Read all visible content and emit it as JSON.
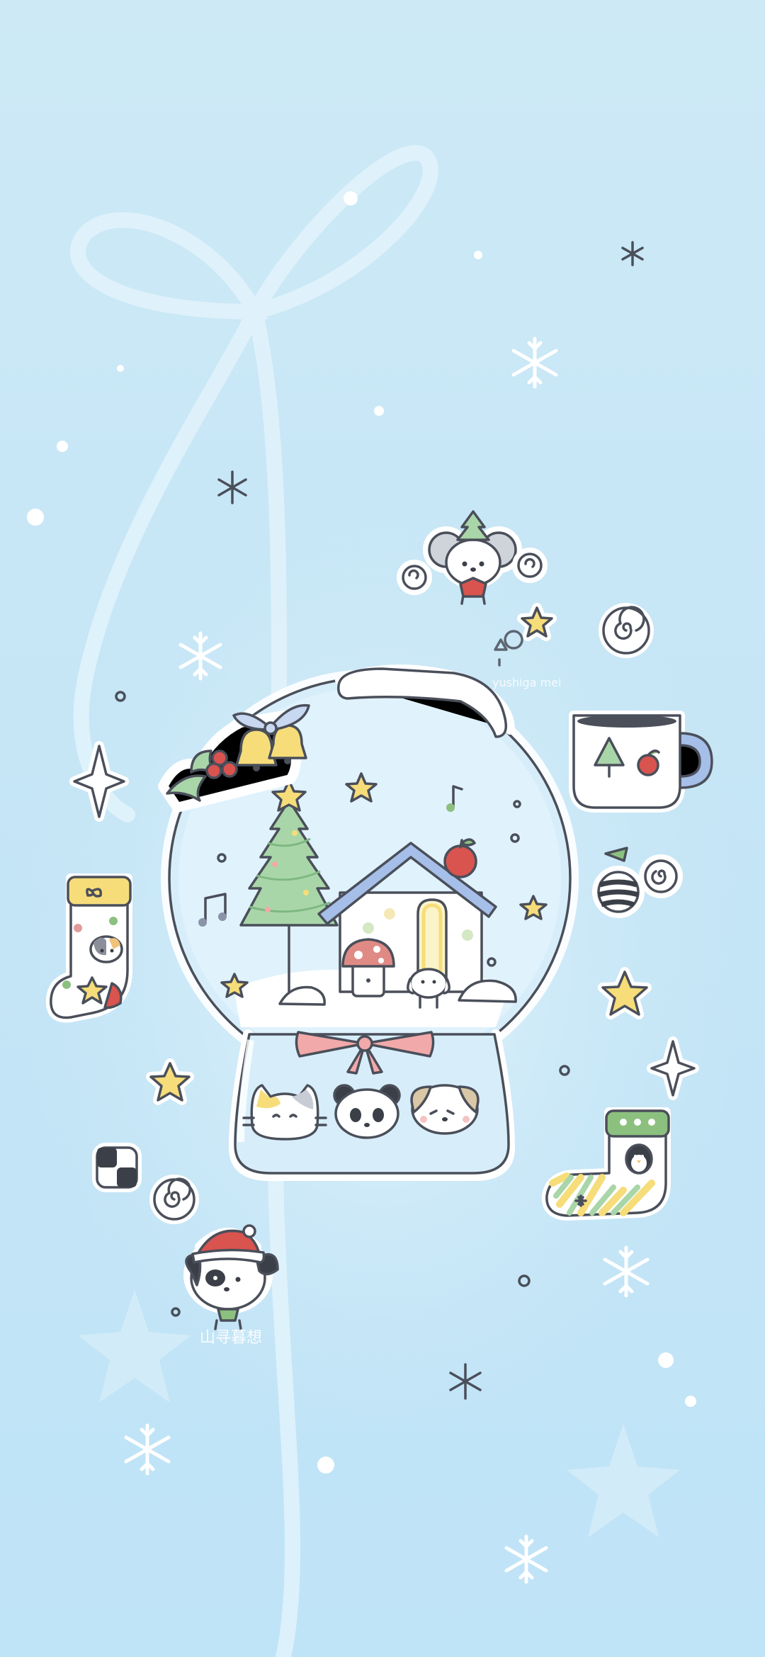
{
  "wallpaper": {
    "theme": "winter snow globe illustration",
    "colors": {
      "background_top": "#cde9f6",
      "background_bottom": "#bfe3f7",
      "ribbon": "#e6f5fc",
      "outline": "#4a4f5a",
      "tree_green": "#a9d6a8",
      "roof_blue": "#a6bfe8",
      "apple_red": "#d9534f",
      "star_yellow": "#f6dd7a",
      "bow_pink": "#f2a9a9",
      "sock_green": "#8cc07f"
    },
    "signatures": {
      "upper_right": "yushiga mei",
      "lower_left": "山寻暮想"
    },
    "icons": [
      "ribbon-decoration",
      "snow-globe",
      "christmas-tree",
      "house",
      "mushroom",
      "puppy",
      "cat-face",
      "panda-face",
      "dog-face",
      "mouse-with-tree-hat",
      "santa-puppy",
      "stocking-cat",
      "stocking-penguin",
      "mug",
      "ornaments",
      "holly-bells",
      "stars",
      "snowflakes",
      "music-notes"
    ]
  }
}
